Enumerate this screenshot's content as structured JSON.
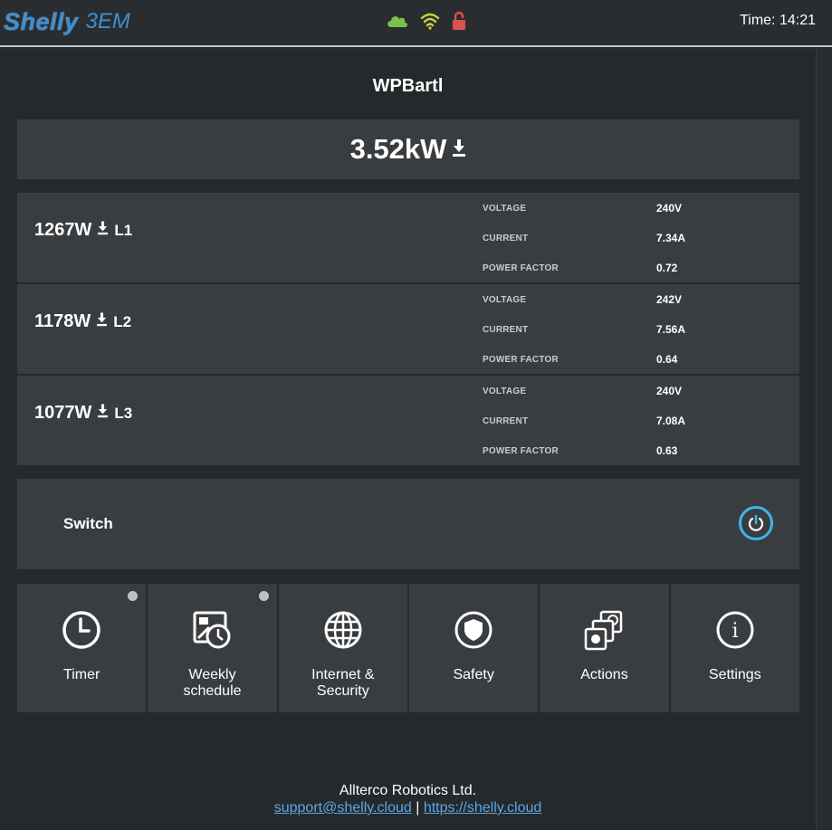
{
  "header": {
    "brand": "Shelly",
    "model": "3EM",
    "status_icons": [
      "cloud-icon",
      "wifi-icon",
      "lock-icon"
    ],
    "clock_label": "Time:",
    "clock_time": "14:21"
  },
  "device": {
    "name": "WPBartl",
    "total_power": "3.52kW"
  },
  "phases": [
    {
      "power": "1267W",
      "label": "L1",
      "voltage_label": "VOLTAGE",
      "voltage": "240V",
      "current_label": "CURRENT",
      "current": "7.34A",
      "pf_label": "POWER FACTOR",
      "pf": "0.72"
    },
    {
      "power": "1178W",
      "label": "L2",
      "voltage_label": "VOLTAGE",
      "voltage": "242V",
      "current_label": "CURRENT",
      "current": "7.56A",
      "pf_label": "POWER FACTOR",
      "pf": "0.64"
    },
    {
      "power": "1077W",
      "label": "L3",
      "voltage_label": "VOLTAGE",
      "voltage": "240V",
      "current_label": "CURRENT",
      "current": "7.08A",
      "pf_label": "POWER FACTOR",
      "pf": "0.63"
    }
  ],
  "switch": {
    "label": "Switch"
  },
  "tiles": [
    {
      "label_1": "Timer",
      "label_2": "",
      "icon": "clock-icon"
    },
    {
      "label_1": "Weekly",
      "label_2": "schedule",
      "icon": "calendar-icon"
    },
    {
      "label_1": "Internet &",
      "label_2": "Security",
      "icon": "globe-icon"
    },
    {
      "label_1": "Safety",
      "label_2": "",
      "icon": "shield-icon"
    },
    {
      "label_1": "Actions",
      "label_2": "",
      "icon": "actions-icon"
    },
    {
      "label_1": "Settings",
      "label_2": "",
      "icon": "info-icon"
    }
  ],
  "footer": {
    "company": "Allterco Robotics Ltd.",
    "email": "support@shelly.cloud",
    "separator": "|",
    "site": "https://shelly.cloud"
  },
  "colors": {
    "accent": "#3fb6ea",
    "brand": "#3f8fd0",
    "cloud": "#7cc24a",
    "wifi": "#c9d43a",
    "lock": "#d9534f",
    "card": "#3a3d40",
    "background": "#25292b"
  }
}
